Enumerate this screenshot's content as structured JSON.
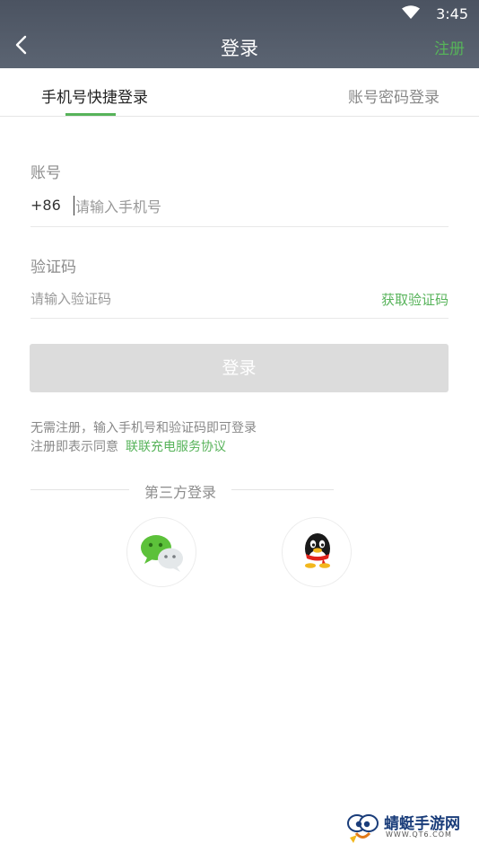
{
  "status_bar": {
    "time": "3:45",
    "wifi_icon": "wifi-icon"
  },
  "header": {
    "title": "登录",
    "register_label": "注册",
    "back_icon": "back-arrow-icon"
  },
  "tabs": [
    {
      "label": "手机号快捷登录",
      "active": true
    },
    {
      "label": "账号密码登录",
      "active": false
    }
  ],
  "form": {
    "account_label": "账号",
    "country_code": "+86",
    "phone_placeholder": "请输入手机号",
    "code_label": "验证码",
    "code_placeholder": "请输入验证码",
    "get_code_label": "获取验证码",
    "login_label": "登录"
  },
  "notice": {
    "line1": "无需注册，输入手机号和验证码即可登录",
    "line2_prefix": "注册即表示同意",
    "agreement_link": "联联充电服务协议"
  },
  "third_party": {
    "title": "第三方登录",
    "options": [
      "wechat-icon",
      "qq-icon"
    ]
  },
  "watermark": {
    "name": "蜻蜓手游网",
    "url": "WWW.QT6.COM"
  },
  "colors": {
    "accent": "#57b35a",
    "header_bg": "#505968",
    "button_disabled": "#dcdcdc"
  }
}
